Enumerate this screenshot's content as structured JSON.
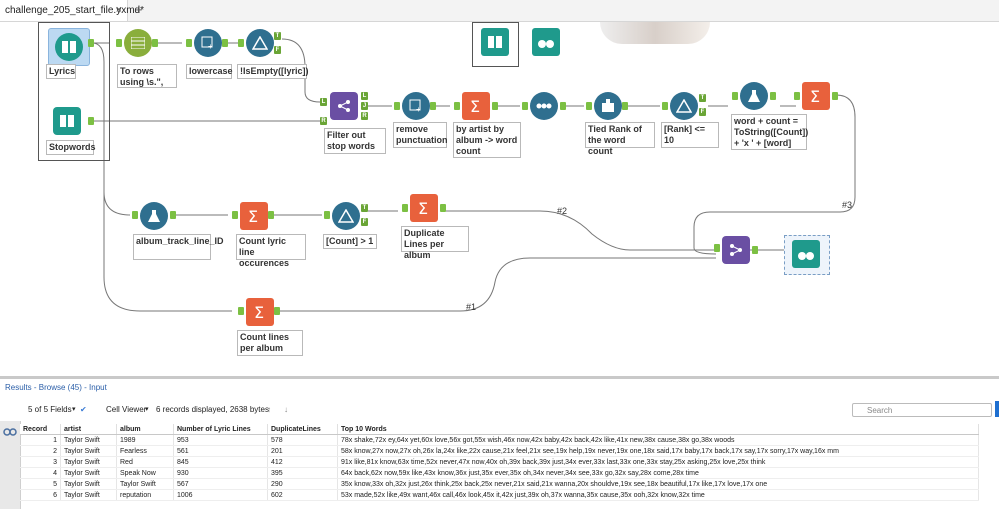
{
  "tab": {
    "title": "challenge_205_start_file.yxmd*",
    "close": "×",
    "add": "+"
  },
  "tools": {
    "lyrics": "Lyrics",
    "stopwords": "Stopwords",
    "to_rows": "To rows using \\s.\",",
    "lowercase": "lowercase",
    "isempty": "!IsEmpty([lyric])",
    "filter_stop": "Filter out stop words",
    "remove_punct": "remove punctuation",
    "by_artist": "by artist by album -> word count",
    "tied_rank": "Tied Rank of the word count",
    "rank_filter": "[Rank] <= 10",
    "word_count_formula": "word + count = ToString([Count]) + 'x ' + [word]",
    "album_track": "album_track_line_ID",
    "count_lyric": "Count lyric line occurences",
    "count_filter": "[Count] > 1",
    "dup_lines": "Duplicate Lines per album",
    "count_lines": "Count lines per album"
  },
  "wire_labels": {
    "w1": "#1",
    "w2": "#2",
    "w3": "#3"
  },
  "ports": {
    "true": "T",
    "false": "F",
    "left": "L",
    "join": "J",
    "right": "R"
  },
  "results": {
    "title": "Results - Browse (45) - Input",
    "fields": "5 of 5 Fields",
    "viewer": "Cell Viewer",
    "records_info": "6 records displayed, 2638 bytes",
    "search_placeholder": "Search",
    "columns": [
      "Record",
      "artist",
      "album",
      "Number of Lyric Lines",
      "DuplicateLines",
      "Top 10 Words"
    ],
    "rows": [
      [
        "1",
        "Taylor Swift",
        "1989",
        "953",
        "578",
        "78x shake,72x ey,64x yet,60x love,56x got,55x wish,46x now,42x baby,42x back,42x like,41x new,38x cause,38x go,38x woods"
      ],
      [
        "2",
        "Taylor Swift",
        "Fearless",
        "561",
        "201",
        "58x know,27x now,27x oh,26x la,24x like,22x cause,21x feel,21x see,19x help,19x never,19x one,18x said,17x baby,17x back,17x say,17x sorry,17x way,16x mm"
      ],
      [
        "3",
        "Taylor Swift",
        "Red",
        "845",
        "412",
        "91x like,81x know,63x time,52x never,47x now,40x oh,39x back,39x just,34x ever,33x last,33x one,33x stay,25x asking,25x love,25x think"
      ],
      [
        "4",
        "Taylor Swift",
        "Speak Now",
        "930",
        "395",
        "64x back,62x now,59x like,43x know,36x just,35x ever,35x oh,34x never,34x see,33x go,32x say,28x come,28x time"
      ],
      [
        "5",
        "Taylor Swift",
        "Taylor Swift",
        "567",
        "290",
        "35x know,33x oh,32x just,26x think,25x back,25x never,21x said,21x wanna,20x shouldve,19x see,18x beautiful,17x like,17x love,17x one"
      ],
      [
        "6",
        "Taylor Swift",
        "reputation",
        "1006",
        "602",
        "53x made,52x like,49x want,46x call,46x look,45x it,42x just,39x oh,37x wanna,35x cause,35x ooh,32x know,32x time"
      ]
    ]
  },
  "colors": {
    "input": "#1f9a8c",
    "prep": "#8aae3c",
    "parse": "#2f6f8f",
    "transform": "#e8613c",
    "join": "#6a4fa3",
    "browse": "#1f9a8c",
    "wire": "#777777"
  }
}
